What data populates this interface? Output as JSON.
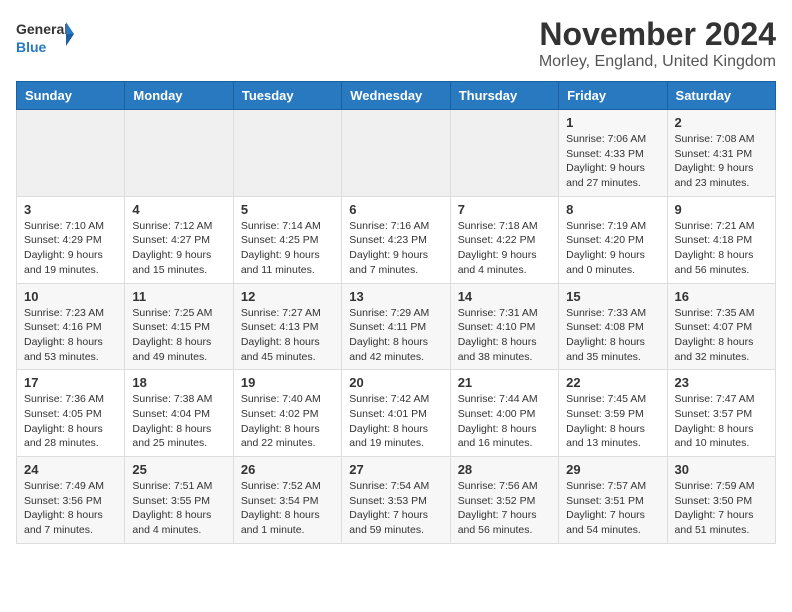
{
  "logo": {
    "line1": "General",
    "line2": "Blue"
  },
  "title": "November 2024",
  "location": "Morley, England, United Kingdom",
  "days_of_week": [
    "Sunday",
    "Monday",
    "Tuesday",
    "Wednesday",
    "Thursday",
    "Friday",
    "Saturday"
  ],
  "weeks": [
    [
      {
        "day": "",
        "info": ""
      },
      {
        "day": "",
        "info": ""
      },
      {
        "day": "",
        "info": ""
      },
      {
        "day": "",
        "info": ""
      },
      {
        "day": "",
        "info": ""
      },
      {
        "day": "1",
        "info": "Sunrise: 7:06 AM\nSunset: 4:33 PM\nDaylight: 9 hours and 27 minutes."
      },
      {
        "day": "2",
        "info": "Sunrise: 7:08 AM\nSunset: 4:31 PM\nDaylight: 9 hours and 23 minutes."
      }
    ],
    [
      {
        "day": "3",
        "info": "Sunrise: 7:10 AM\nSunset: 4:29 PM\nDaylight: 9 hours and 19 minutes."
      },
      {
        "day": "4",
        "info": "Sunrise: 7:12 AM\nSunset: 4:27 PM\nDaylight: 9 hours and 15 minutes."
      },
      {
        "day": "5",
        "info": "Sunrise: 7:14 AM\nSunset: 4:25 PM\nDaylight: 9 hours and 11 minutes."
      },
      {
        "day": "6",
        "info": "Sunrise: 7:16 AM\nSunset: 4:23 PM\nDaylight: 9 hours and 7 minutes."
      },
      {
        "day": "7",
        "info": "Sunrise: 7:18 AM\nSunset: 4:22 PM\nDaylight: 9 hours and 4 minutes."
      },
      {
        "day": "8",
        "info": "Sunrise: 7:19 AM\nSunset: 4:20 PM\nDaylight: 9 hours and 0 minutes."
      },
      {
        "day": "9",
        "info": "Sunrise: 7:21 AM\nSunset: 4:18 PM\nDaylight: 8 hours and 56 minutes."
      }
    ],
    [
      {
        "day": "10",
        "info": "Sunrise: 7:23 AM\nSunset: 4:16 PM\nDaylight: 8 hours and 53 minutes."
      },
      {
        "day": "11",
        "info": "Sunrise: 7:25 AM\nSunset: 4:15 PM\nDaylight: 8 hours and 49 minutes."
      },
      {
        "day": "12",
        "info": "Sunrise: 7:27 AM\nSunset: 4:13 PM\nDaylight: 8 hours and 45 minutes."
      },
      {
        "day": "13",
        "info": "Sunrise: 7:29 AM\nSunset: 4:11 PM\nDaylight: 8 hours and 42 minutes."
      },
      {
        "day": "14",
        "info": "Sunrise: 7:31 AM\nSunset: 4:10 PM\nDaylight: 8 hours and 38 minutes."
      },
      {
        "day": "15",
        "info": "Sunrise: 7:33 AM\nSunset: 4:08 PM\nDaylight: 8 hours and 35 minutes."
      },
      {
        "day": "16",
        "info": "Sunrise: 7:35 AM\nSunset: 4:07 PM\nDaylight: 8 hours and 32 minutes."
      }
    ],
    [
      {
        "day": "17",
        "info": "Sunrise: 7:36 AM\nSunset: 4:05 PM\nDaylight: 8 hours and 28 minutes."
      },
      {
        "day": "18",
        "info": "Sunrise: 7:38 AM\nSunset: 4:04 PM\nDaylight: 8 hours and 25 minutes."
      },
      {
        "day": "19",
        "info": "Sunrise: 7:40 AM\nSunset: 4:02 PM\nDaylight: 8 hours and 22 minutes."
      },
      {
        "day": "20",
        "info": "Sunrise: 7:42 AM\nSunset: 4:01 PM\nDaylight: 8 hours and 19 minutes."
      },
      {
        "day": "21",
        "info": "Sunrise: 7:44 AM\nSunset: 4:00 PM\nDaylight: 8 hours and 16 minutes."
      },
      {
        "day": "22",
        "info": "Sunrise: 7:45 AM\nSunset: 3:59 PM\nDaylight: 8 hours and 13 minutes."
      },
      {
        "day": "23",
        "info": "Sunrise: 7:47 AM\nSunset: 3:57 PM\nDaylight: 8 hours and 10 minutes."
      }
    ],
    [
      {
        "day": "24",
        "info": "Sunrise: 7:49 AM\nSunset: 3:56 PM\nDaylight: 8 hours and 7 minutes."
      },
      {
        "day": "25",
        "info": "Sunrise: 7:51 AM\nSunset: 3:55 PM\nDaylight: 8 hours and 4 minutes."
      },
      {
        "day": "26",
        "info": "Sunrise: 7:52 AM\nSunset: 3:54 PM\nDaylight: 8 hours and 1 minute."
      },
      {
        "day": "27",
        "info": "Sunrise: 7:54 AM\nSunset: 3:53 PM\nDaylight: 7 hours and 59 minutes."
      },
      {
        "day": "28",
        "info": "Sunrise: 7:56 AM\nSunset: 3:52 PM\nDaylight: 7 hours and 56 minutes."
      },
      {
        "day": "29",
        "info": "Sunrise: 7:57 AM\nSunset: 3:51 PM\nDaylight: 7 hours and 54 minutes."
      },
      {
        "day": "30",
        "info": "Sunrise: 7:59 AM\nSunset: 3:50 PM\nDaylight: 7 hours and 51 minutes."
      }
    ]
  ]
}
